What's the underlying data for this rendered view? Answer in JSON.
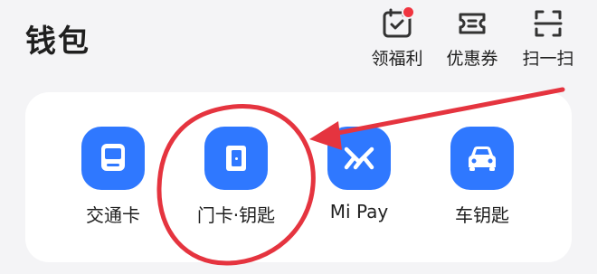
{
  "wallet": {
    "title": "钱包",
    "header_actions": [
      {
        "label": "领福利",
        "icon": "calendar-check-icon"
      },
      {
        "label": "优惠券",
        "icon": "ticket-icon"
      },
      {
        "label": "扫一扫",
        "icon": "scan-icon"
      }
    ],
    "cards": [
      {
        "label": "交通卡",
        "icon": "bus-card-icon"
      },
      {
        "label": "门卡·钥匙",
        "icon": "door-card-icon"
      },
      {
        "label": "Mi Pay",
        "icon": "mi-pay-icon"
      },
      {
        "label": "车钥匙",
        "icon": "car-icon"
      }
    ]
  },
  "colors": {
    "accent": "#2f78ff",
    "annotation": "#e5343f",
    "badge_dot": "#f0343f"
  }
}
